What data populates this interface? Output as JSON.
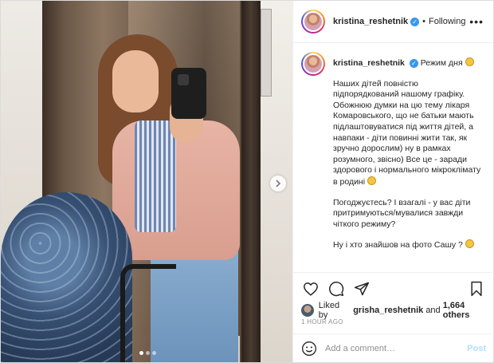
{
  "header": {
    "username": "kristina_reshetnik",
    "separator": "•",
    "follow_status": "Following",
    "more_label": "•••"
  },
  "caption": {
    "username": "kristina_reshetnik",
    "first_line": "Режим дня",
    "paragraphs": [
      "Наших дітей повністю підпорядкований нашому графіку. Обожнюю думки на цю тему лікаря Комаровського, що не батьки мають підлаштовуватися під життя дітей, а навпаки - діти повинні жити так, як зручно дорослим) ну в рамках розумного, звісно) Все це - заради здорового і нормального мікроклімату в родині",
      "Погоджуєтесь? І взагалі - у вас діти притримуються/мувалися завжди чіткого режиму?",
      "Ну і хто знайшов на фото Сашу ?"
    ]
  },
  "likes": {
    "prefix": "Liked by",
    "user": "grisha_reshetnik",
    "connector": "and",
    "count": "1,664 others"
  },
  "timestamp": "1 HOUR AGO",
  "comment": {
    "placeholder": "Add a comment…",
    "post_label": "Post"
  },
  "carousel": {
    "total_slides": 3,
    "active_slide": 1
  },
  "icons": {
    "verified": "verified-badge-icon",
    "like": "heart-icon",
    "comment": "comment-icon",
    "share": "share-icon",
    "save": "bookmark-icon",
    "emoji": "smiley-icon",
    "next": "chevron-right-icon"
  },
  "colors": {
    "accent": "#3897f0",
    "post_disabled": "#b2dffc",
    "text": "#262626",
    "muted": "#8e8e8e"
  }
}
